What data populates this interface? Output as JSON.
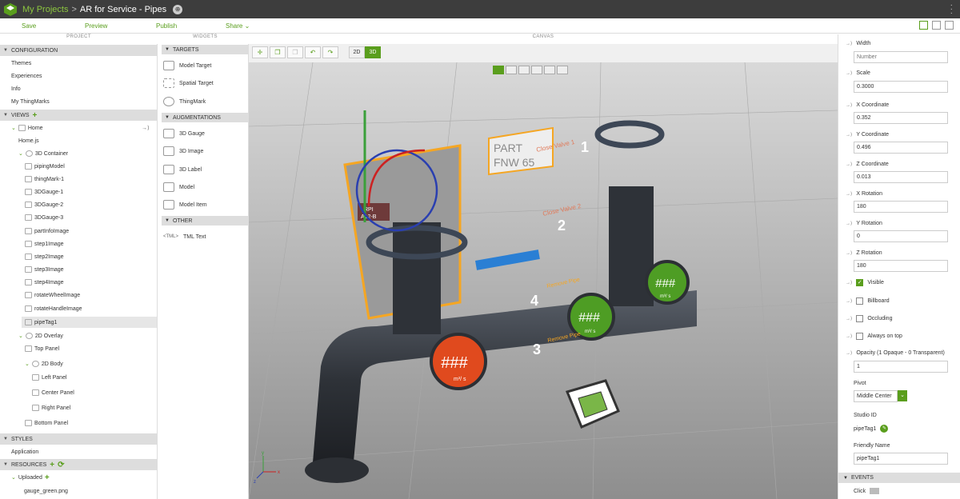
{
  "titlebar": {
    "breadcrumb_root": "My Projects",
    "separator": ">",
    "title": "AR for Service - Pipes"
  },
  "toolbar": {
    "save": "Save",
    "preview": "Preview",
    "publish": "Publish",
    "share": "Share"
  },
  "panels": {
    "project": "PROJECT",
    "widgets": "WIDGETS",
    "canvas": "CANVAS"
  },
  "project": {
    "configuration": "CONFIGURATION",
    "config_items": [
      "Themes",
      "Experiences",
      "Info",
      "My ThingMarks"
    ],
    "views": "VIEWS",
    "home": "Home",
    "home_js": "Home.js",
    "container_3d": "3D Container",
    "container_children": [
      "pipingModel",
      "thingMark-1",
      "3DGauge-1",
      "3DGauge-2",
      "3DGauge-3",
      "partInfoImage",
      "step1Image",
      "step2Image",
      "step3Image",
      "step4Image",
      "rotateWheelImage",
      "rotateHandleImage",
      "pipeTag1"
    ],
    "overlay_2d": "2D Overlay",
    "top_panel": "Top Panel",
    "body_2d": "2D Body",
    "body_children": [
      "Left Panel",
      "Center Panel",
      "Right Panel"
    ],
    "bottom_panel": "Bottom Panel",
    "styles": "STYLES",
    "application": "Application",
    "resources": "RESOURCES",
    "uploaded": "Uploaded",
    "uploaded_file": "gauge_green.png"
  },
  "widgets": {
    "targets": "TARGETS",
    "target_items": [
      "Model Target",
      "Spatial Target",
      "ThingMark"
    ],
    "augmentations": "AUGMENTATIONS",
    "augmentation_items": [
      "3D Gauge",
      "3D Image",
      "3D Label",
      "Model",
      "Model Item"
    ],
    "other": "OTHER",
    "other_items": [
      "TML Text"
    ]
  },
  "canvas": {
    "mode_2d": "2D",
    "mode_3d": "3D",
    "labels": {
      "part": "PART",
      "part_no": "FNW 65",
      "rpi": "RPI",
      "rpi_code": "A12-B",
      "close_valve_1": "Close Valve 1",
      "close_valve_2": "Close Valve 2",
      "remove_pipe": "Remove Pipe",
      "gauge_text": "###",
      "gauge_unit": "m³/ s",
      "step_1": "1",
      "step_2": "2",
      "step_3": "3",
      "step_4": "4",
      "axis_x": "x",
      "axis_y": "y",
      "axis_z": "z"
    }
  },
  "properties": {
    "width_label": "Width",
    "width_placeholder": "Number",
    "scale_label": "Scale",
    "scale": "0.3000",
    "x_label": "X Coordinate",
    "x": "0.352",
    "y_label": "Y Coordinate",
    "y": "0.496",
    "z_label": "Z Coordinate",
    "z": "0.013",
    "xr_label": "X Rotation",
    "xr": "180",
    "yr_label": "Y Rotation",
    "yr": "0",
    "zr_label": "Z Rotation",
    "zr": "180",
    "visible": "Visible",
    "billboard": "Billboard",
    "occluding": "Occluding",
    "always_on_top": "Always on top",
    "opacity_label": "Opacity (1 Opaque - 0 Transparent)",
    "opacity": "1",
    "pivot_label": "Pivot",
    "pivot": "Middle Center",
    "studio_id_label": "Studio ID",
    "studio_id": "pipeTag1",
    "friendly_name_label": "Friendly Name",
    "friendly_name": "pipeTag1",
    "events": "EVENTS",
    "click_event": "Click"
  },
  "colors": {
    "accent": "#5a9e1d",
    "titlebar": "#3d3d3d",
    "gauge_red": "#e04a1e",
    "gauge_green": "#4e9d24",
    "panel_orange": "#f5a623"
  }
}
